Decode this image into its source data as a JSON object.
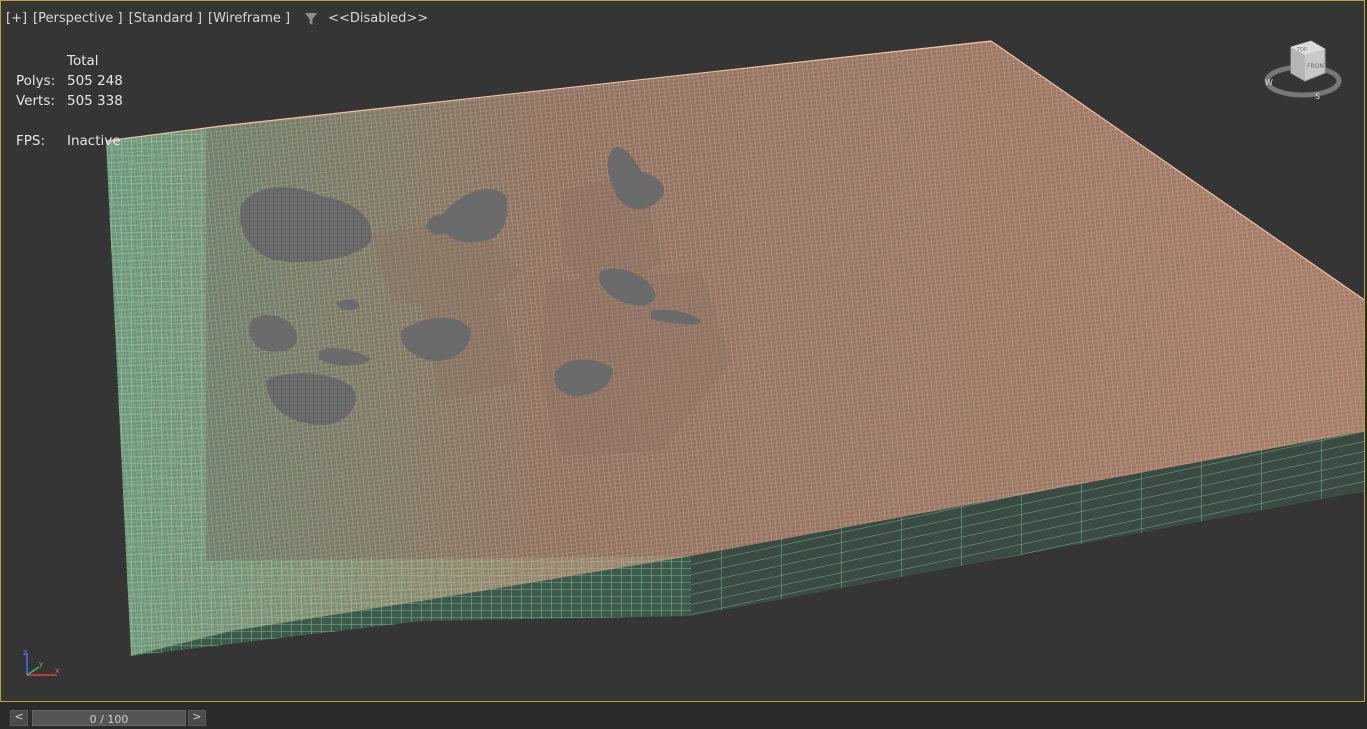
{
  "viewport": {
    "labels": {
      "plus": "[+]",
      "view": "[Perspective ]",
      "shading": "[Standard ]",
      "mode": "[Wireframe ]",
      "filter_icon": "filter-icon",
      "filter_status": "<<Disabled>>"
    },
    "stats": {
      "header": "Total",
      "polys_label": "Polys:",
      "polys_value": "505 248",
      "verts_label": "Verts:",
      "verts_value": "505 338",
      "fps_label": "FPS:",
      "fps_value": "Inactive"
    },
    "viewcube": {
      "face_label": "FRONT",
      "top_label": "TOP",
      "compass": {
        "w": "W",
        "s": "S"
      }
    },
    "axis_gizmo": {
      "z": "z",
      "x": "x",
      "y": "y"
    },
    "colors": {
      "terrain_wire": "#d9a184",
      "terrain_fill": "#c89a80",
      "side_wire": "#7fe0b0",
      "rock": "#6a6a6a",
      "border_active": "#b8a23a"
    }
  },
  "timeline": {
    "prev_label": "<",
    "slider_label": "0 / 100",
    "next_label": ">"
  }
}
